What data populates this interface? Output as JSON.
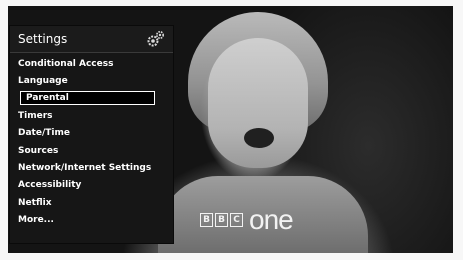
{
  "menu": {
    "title": "Settings",
    "icon": "gear-settings-icon",
    "selected_index": 2,
    "items": [
      {
        "label": "Conditional Access"
      },
      {
        "label": "Language"
      },
      {
        "label": "Parental"
      },
      {
        "label": "Timers"
      },
      {
        "label": "Date/Time"
      },
      {
        "label": "Sources"
      },
      {
        "label": "Network/Internet Settings"
      },
      {
        "label": "Accessibility"
      },
      {
        "label": "Netflix"
      },
      {
        "label": "More..."
      }
    ]
  },
  "channel_logo": {
    "brand": [
      "B",
      "B",
      "C"
    ],
    "channel": "one"
  },
  "colors": {
    "menu_background": "#161616",
    "menu_text": "#ffffff",
    "selection_border": "#ffffff"
  }
}
